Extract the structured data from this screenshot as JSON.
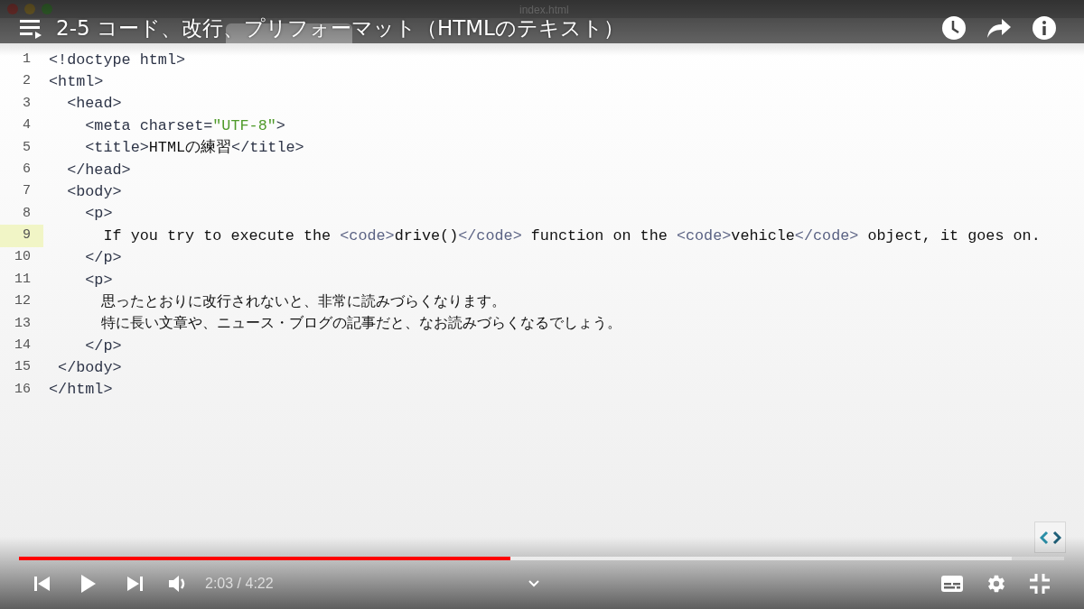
{
  "video_title": "2-5 コード、改行、プリフォーマット（HTMLのテキスト）",
  "editor": {
    "window_title": "index.html",
    "lines": [
      {
        "number": "1",
        "selected": false,
        "tokens": [
          {
            "kind": "tag",
            "text": "<!doctype html>"
          }
        ]
      },
      {
        "number": "2",
        "selected": false,
        "tokens": [
          {
            "kind": "tag",
            "text": "<html>"
          }
        ]
      },
      {
        "number": "3",
        "selected": false,
        "tokens": [
          {
            "kind": "tag",
            "text": "  <head>"
          }
        ]
      },
      {
        "number": "4",
        "selected": false,
        "tokens": [
          {
            "kind": "tag",
            "text": "    <meta charset="
          },
          {
            "kind": "string",
            "text": "\"UTF-8\""
          },
          {
            "kind": "tag",
            "text": ">"
          }
        ]
      },
      {
        "number": "5",
        "selected": false,
        "tokens": [
          {
            "kind": "tag",
            "text": "    <title>"
          },
          {
            "kind": "text",
            "text": "HTMLの練習"
          },
          {
            "kind": "tag",
            "text": "</title>"
          }
        ]
      },
      {
        "number": "6",
        "selected": false,
        "tokens": [
          {
            "kind": "tag",
            "text": "  </head>"
          }
        ]
      },
      {
        "number": "7",
        "selected": false,
        "tokens": [
          {
            "kind": "tag",
            "text": "  <body>"
          }
        ]
      },
      {
        "number": "8",
        "selected": false,
        "tokens": [
          {
            "kind": "tag",
            "text": "    <p>"
          }
        ]
      },
      {
        "number": "9",
        "selected": true,
        "tokens": [
          {
            "kind": "text",
            "text": "      If you try to execute the "
          },
          {
            "kind": "inline",
            "text": "<code>"
          },
          {
            "kind": "text",
            "text": "drive()"
          },
          {
            "kind": "inline",
            "text": "</code>"
          },
          {
            "kind": "text",
            "text": " function on the "
          },
          {
            "kind": "inline",
            "text": "<code>"
          },
          {
            "kind": "text",
            "text": "vehicle"
          },
          {
            "kind": "inline",
            "text": "</code>"
          },
          {
            "kind": "text",
            "text": " object, it goes on."
          }
        ]
      },
      {
        "number": "10",
        "selected": false,
        "tokens": [
          {
            "kind": "tag",
            "text": "    </p>"
          }
        ]
      },
      {
        "number": "11",
        "selected": false,
        "tokens": [
          {
            "kind": "tag",
            "text": "    <p>"
          }
        ]
      },
      {
        "number": "12",
        "selected": false,
        "tokens": [
          {
            "kind": "jp",
            "text": "      思ったとおりに改行されないと、非常に読みづらくなります。"
          }
        ]
      },
      {
        "number": "13",
        "selected": false,
        "tokens": [
          {
            "kind": "jp",
            "text": "      特に長い文章や、ニュース・ブログの記事だと、なお読みづらくなるでしょう。"
          }
        ]
      },
      {
        "number": "14",
        "selected": false,
        "tokens": [
          {
            "kind": "tag",
            "text": "    </p>"
          }
        ]
      },
      {
        "number": "15",
        "selected": false,
        "tokens": [
          {
            "kind": "tag",
            "text": " </body>"
          }
        ]
      },
      {
        "number": "16",
        "selected": false,
        "tokens": [
          {
            "kind": "tag",
            "text": "</html>"
          }
        ]
      }
    ]
  },
  "player": {
    "progress": {
      "level": 0.47
    },
    "buffer": {
      "level": 0.95
    },
    "time": "2:03 / 4:22"
  }
}
